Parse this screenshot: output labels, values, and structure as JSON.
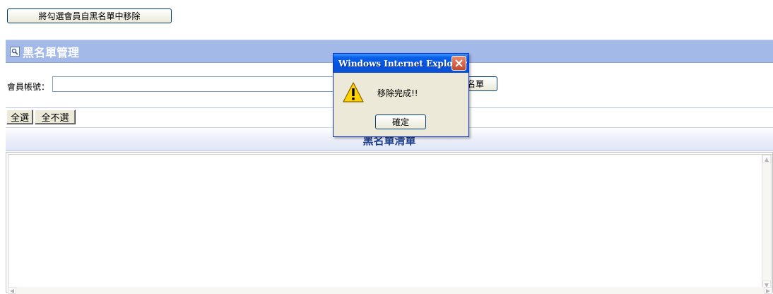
{
  "toolbar": {
    "remove_label": "將勾選會員自黑名單中移除"
  },
  "panel": {
    "title": "黑名單管理",
    "icon": "magnifier-icon"
  },
  "account": {
    "label": "會員帳號：",
    "value": "",
    "add_button_label": "名單"
  },
  "selection": {
    "select_all_label": "全選",
    "select_none_label": "全不選"
  },
  "list": {
    "title": "黑名單清單"
  },
  "dialog": {
    "title": "Windows Internet Explorer",
    "message": "移除完成!!",
    "ok_label": "確定",
    "icon": "warning-icon"
  },
  "colors": {
    "header_bg": "#a3b9e8",
    "titlebar": "#0355e0",
    "list_title": "#1e3f8c"
  }
}
